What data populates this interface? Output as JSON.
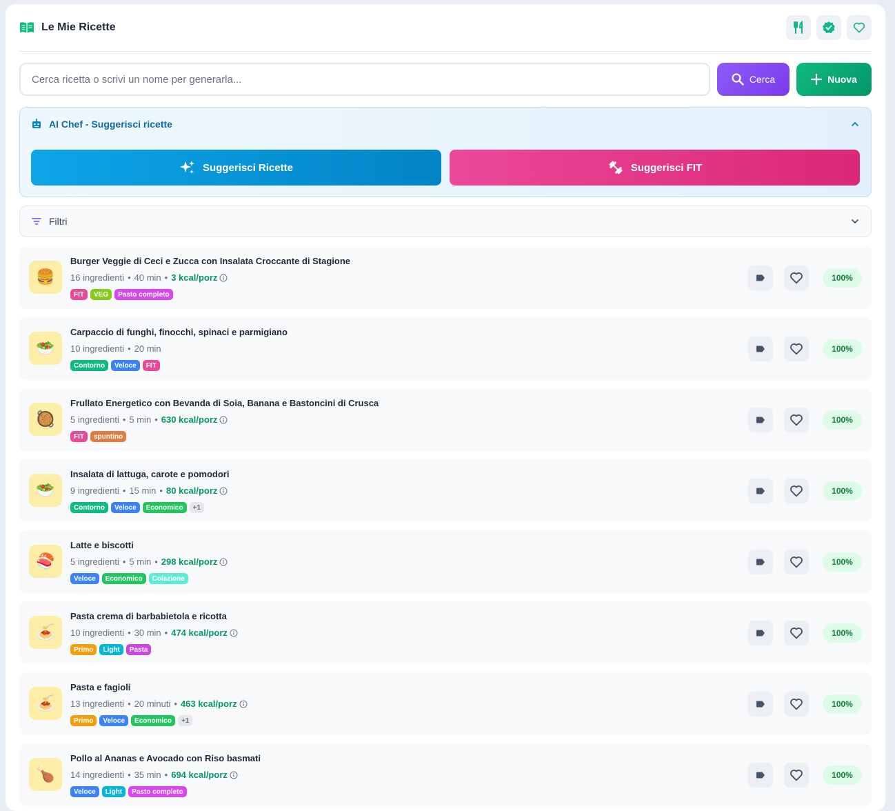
{
  "app": {
    "title": "Le Mie Ricette"
  },
  "header_icons": [
    "cutlery-icon",
    "verified-badge-icon",
    "heart-outline-icon"
  ],
  "search": {
    "placeholder": "Cerca ricetta o scrivi un nome per generarla...",
    "search_label": "Cerca",
    "new_label": "Nuova"
  },
  "aichef": {
    "title": "AI Chef - Suggerisci ricette",
    "suggest_label": "Suggerisci Ricette",
    "fit_label": "Suggerisci FIT"
  },
  "filters": {
    "label": "Filtri"
  },
  "colors": {
    "FIT": "#ec4899",
    "VEG": "#84cc16",
    "Pasto completo": "#d946ef",
    "Contorno": "#10b981",
    "Veloce": "#3b82f6",
    "spuntino": "#e07a3f",
    "Economico": "#22c55e",
    "Colazione": "#5eead4",
    "Primo": "#f59e0b",
    "Light": "#06b6d4",
    "Pasta": "#c946e0"
  },
  "recipes": [
    {
      "name": "Burger Veggie di Ceci e Zucca con Insalata Croccante di Stagione",
      "ingredients": "16 ingredienti",
      "time": "40 min",
      "kcal": "3 kcal/porz",
      "tags": [
        "FIT",
        "VEG",
        "Pasto completo"
      ],
      "more": "",
      "emoji": "🍔",
      "match": "100%"
    },
    {
      "name": "Carpaccio di funghi, finocchi, spinaci e parmigiano",
      "ingredients": "10 ingredienti",
      "time": "20 min",
      "kcal": "",
      "tags": [
        "Contorno",
        "Veloce",
        "FIT"
      ],
      "more": "",
      "emoji": "🥗",
      "match": "100%"
    },
    {
      "name": "Frullato Energetico con Bevanda di Soia, Banana e Bastoncini di Crusca",
      "ingredients": "5 ingredienti",
      "time": "5 min",
      "kcal": "630 kcal/porz",
      "tags": [
        "FIT",
        "spuntino"
      ],
      "more": "",
      "emoji": "🥘",
      "match": "100%"
    },
    {
      "name": "Insalata di lattuga, carote e pomodori",
      "ingredients": "9 ingredienti",
      "time": "15 min",
      "kcal": "80 kcal/porz",
      "tags": [
        "Contorno",
        "Veloce",
        "Economico"
      ],
      "more": "+1",
      "emoji": "🥗",
      "match": "100%"
    },
    {
      "name": "Latte e biscotti",
      "ingredients": "5 ingredienti",
      "time": "5 min",
      "kcal": "298 kcal/porz",
      "tags": [
        "Veloce",
        "Economico",
        "Colazione"
      ],
      "more": "",
      "emoji": "🍣",
      "match": "100%"
    },
    {
      "name": "Pasta crema di barbabietola e ricotta",
      "ingredients": "10 ingredienti",
      "time": "30 min",
      "kcal": "474 kcal/porz",
      "tags": [
        "Primo",
        "Light",
        "Pasta"
      ],
      "more": "",
      "emoji": "🍝",
      "match": "100%"
    },
    {
      "name": "Pasta e fagioli",
      "ingredients": "13 ingredienti",
      "time": "20 minuti",
      "kcal": "463 kcal/porz",
      "tags": [
        "Primo",
        "Veloce",
        "Economico"
      ],
      "more": "+1",
      "emoji": "🍝",
      "match": "100%"
    },
    {
      "name": "Pollo al Ananas e Avocado con Riso basmati",
      "ingredients": "14 ingredienti",
      "time": "35 min",
      "kcal": "694 kcal/porz",
      "tags": [
        "Veloce",
        "Light",
        "Pasto completo"
      ],
      "more": "",
      "emoji": "🍗",
      "match": "100%"
    }
  ]
}
